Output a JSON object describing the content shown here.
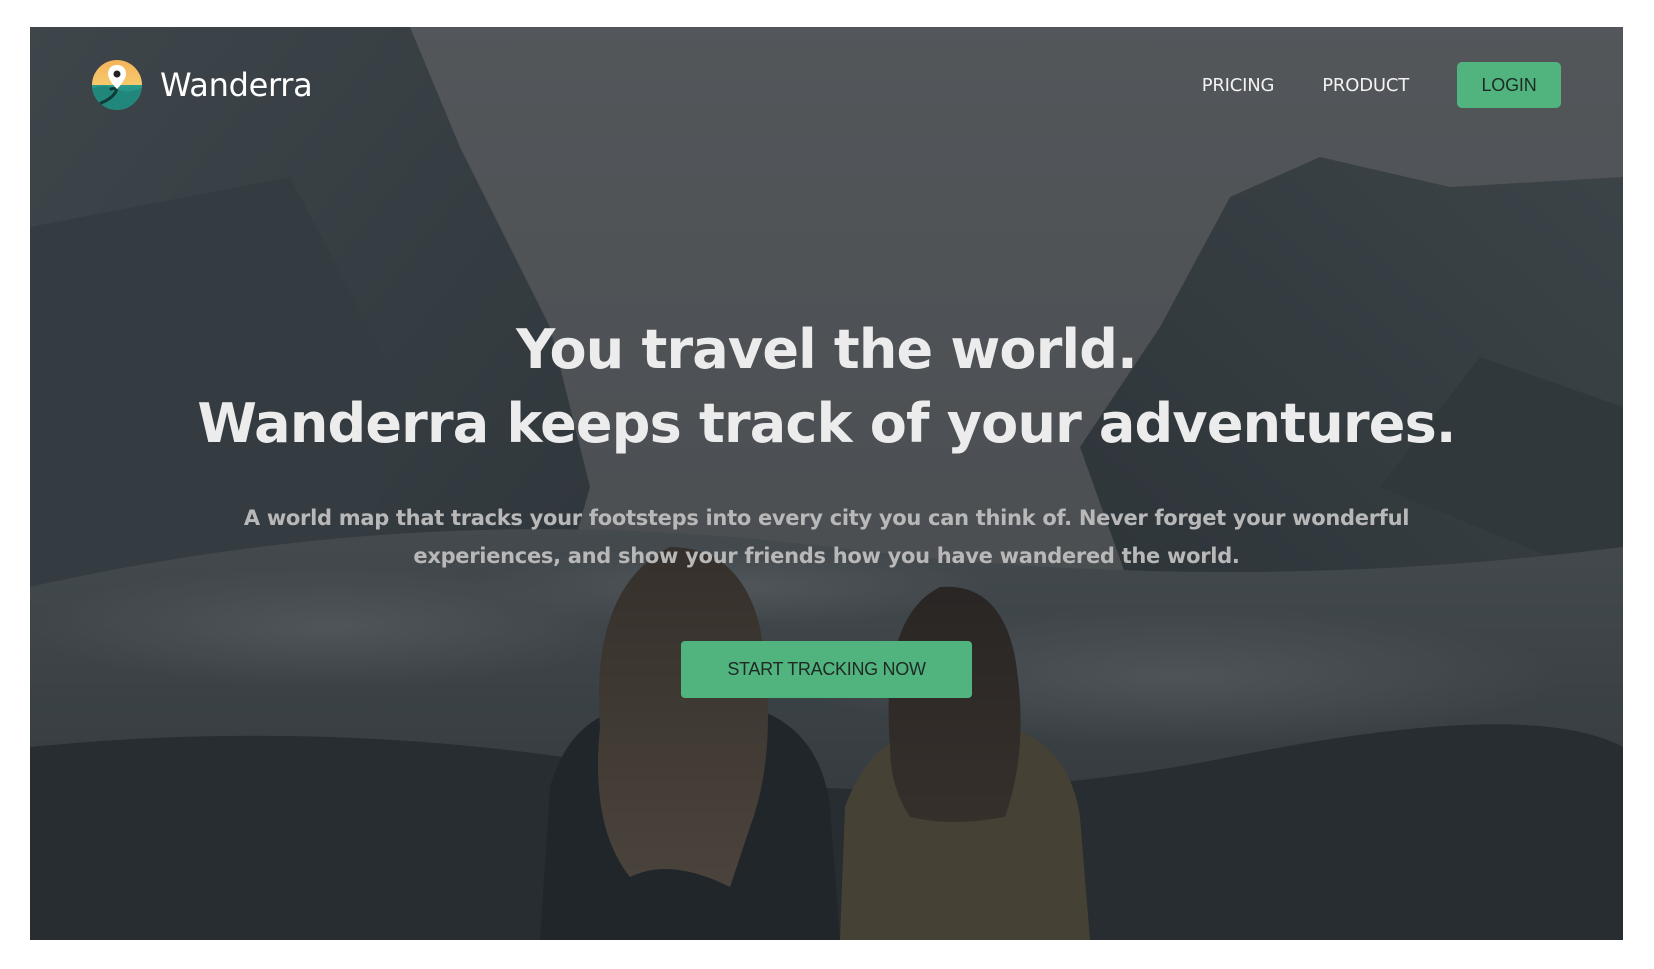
{
  "brand": {
    "name": "Wanderra",
    "logo_icon": "map-pin-globe-icon"
  },
  "nav": {
    "links": [
      "PRICING",
      "PRODUCT"
    ],
    "login_label": "LOGIN"
  },
  "hero": {
    "title_line1": "You travel the world.",
    "title_line2": "Wanderra keeps track of your adventures.",
    "subtitle": "A world map that tracks your footsteps into every city you can think of. Never forget your wonderful experiences, and show your friends how you have wandered the world.",
    "cta_label": "START TRACKING NOW"
  },
  "colors": {
    "accent": "#51b47e",
    "overlay": "#24282c"
  }
}
